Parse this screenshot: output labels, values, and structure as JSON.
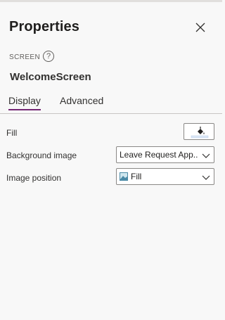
{
  "panel": {
    "title": "Properties",
    "section_label": "SCREEN",
    "help_icon": "question-circle-icon",
    "close_icon": "close-icon",
    "screen_name": "WelcomeScreen"
  },
  "tabs": [
    {
      "label": "Display",
      "active": true
    },
    {
      "label": "Advanced",
      "active": false
    }
  ],
  "properties": {
    "fill": {
      "label": "Fill",
      "icon": "paint-bucket-icon",
      "swatch_color": "#dbe7f7"
    },
    "background_image": {
      "label": "Background image",
      "value": "Leave Request App..."
    },
    "image_position": {
      "label": "Image position",
      "value": "Fill",
      "icon": "image-thumbnail-icon"
    }
  },
  "colors": {
    "accent": "#742774",
    "border": "#8a8886"
  }
}
